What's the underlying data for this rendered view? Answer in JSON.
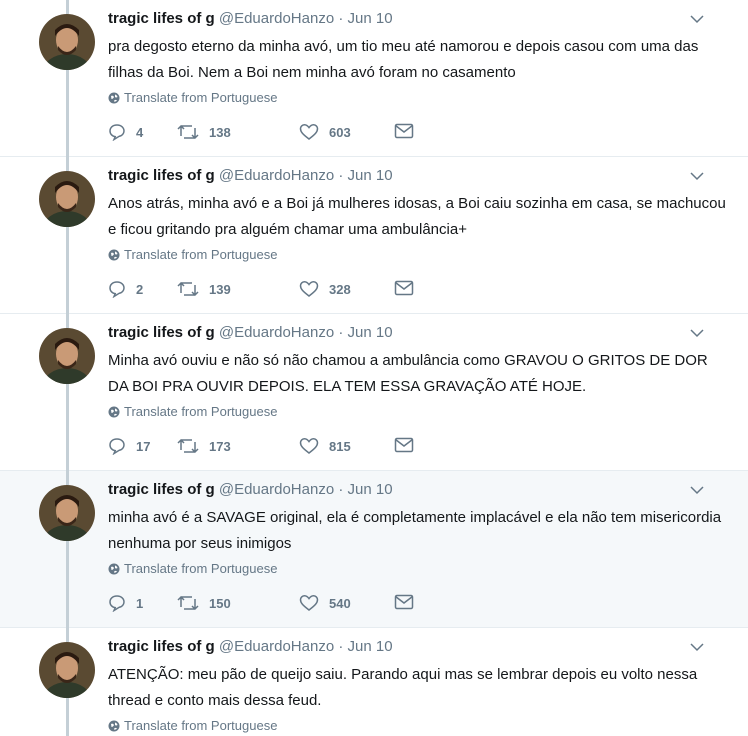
{
  "colors": {
    "text": "#14171a",
    "muted": "#657786",
    "thread_line": "#c4cfd6",
    "highlight_bg": "#f5f8fa"
  },
  "tweets": [
    {
      "name": "tragic lifes of g",
      "handle": "@EduardoHanzo",
      "sep": "·",
      "date": "Jun 10",
      "text": "pra degosto eterno da minha avó, um tio meu até namorou e depois casou com uma das filhas da Boi. Nem a Boi nem minha avó foram no casamento",
      "translate": "Translate from Portuguese",
      "replies": "4",
      "retweets": "138",
      "likes": "603"
    },
    {
      "name": "tragic lifes of g",
      "handle": "@EduardoHanzo",
      "sep": "·",
      "date": "Jun 10",
      "text": "Anos atrás, minha avó e a Boi já mulheres idosas, a Boi caiu sozinha em casa, se machucou e ficou gritando pra alguém chamar uma ambulância+",
      "translate": "Translate from Portuguese",
      "replies": "2",
      "retweets": "139",
      "likes": "328"
    },
    {
      "name": "tragic lifes of g",
      "handle": "@EduardoHanzo",
      "sep": "·",
      "date": "Jun 10",
      "text": "Minha avó ouviu e não só não chamou a ambulância como GRAVOU O GRITOS DE DOR DA BOI PRA OUVIR DEPOIS. ELA TEM ESSA GRAVAÇÃO ATÉ HOJE.",
      "translate": "Translate from Portuguese",
      "replies": "17",
      "retweets": "173",
      "likes": "815"
    },
    {
      "name": "tragic lifes of g",
      "handle": "@EduardoHanzo",
      "sep": "·",
      "date": "Jun 10",
      "text": "minha avó é a SAVAGE original, ela é completamente implacável e ela não tem misericordia nenhuma por seus inimigos",
      "translate": "Translate from Portuguese",
      "replies": "1",
      "retweets": "150",
      "likes": "540"
    },
    {
      "name": "tragic lifes of g",
      "handle": "@EduardoHanzo",
      "sep": "·",
      "date": "Jun 10",
      "text": "ATENÇÃO: meu pão de queijo saiu. Parando aqui mas se lembrar depois eu volto nessa thread e conto mais dessa feud.",
      "translate": "Translate from Portuguese"
    }
  ]
}
